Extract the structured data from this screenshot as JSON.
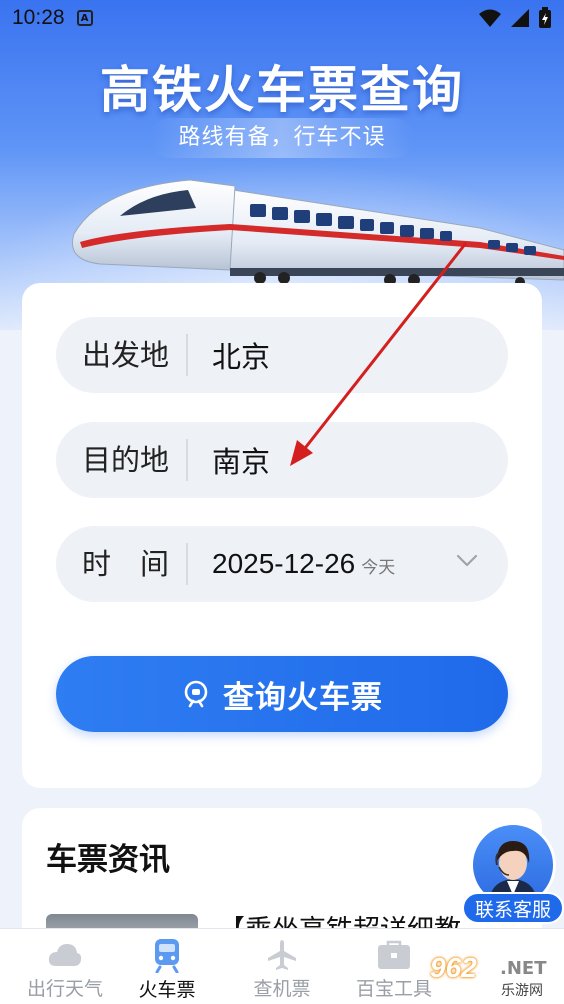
{
  "status_bar": {
    "time": "10:28",
    "notification_icon": "a-badge-icon",
    "icons": [
      "wifi-icon",
      "signal-icon",
      "battery-icon"
    ]
  },
  "hero": {
    "title": "高铁火车票查询",
    "subtitle": "路线有备，行车不误"
  },
  "search_form": {
    "from_label": "出发地",
    "from_value": "北京",
    "to_label": "目的地",
    "to_value": "南京",
    "date_label": "时　间",
    "date_value": "2025-12-26",
    "date_hint": "今天",
    "submit_label": "查询火车票",
    "submit_icon": "train-front-icon"
  },
  "news": {
    "section_title": "车票资讯",
    "headline": "【乘坐高铁超详细教"
  },
  "bottom_nav": {
    "items": [
      {
        "label": "出行天气",
        "icon": "cloud-icon",
        "active": false
      },
      {
        "label": "火车票",
        "icon": "train-icon",
        "active": true
      },
      {
        "label": "查机票",
        "icon": "airplane-icon",
        "active": false
      },
      {
        "label": "百宝工具",
        "icon": "toolbox-icon",
        "active": false
      }
    ]
  },
  "customer_service": {
    "label": "联系客服",
    "icon": "agent-avatar-icon"
  },
  "watermark": {
    "brand": "962.NET",
    "number": "962",
    "domain_suffix": ".NET",
    "chinese": "乐游网"
  },
  "colors": {
    "accent": "#1f6aea",
    "hero_top": "#3a73f0",
    "field_bg": "#eef1f6",
    "annotation_arrow": "#d41f1f"
  }
}
